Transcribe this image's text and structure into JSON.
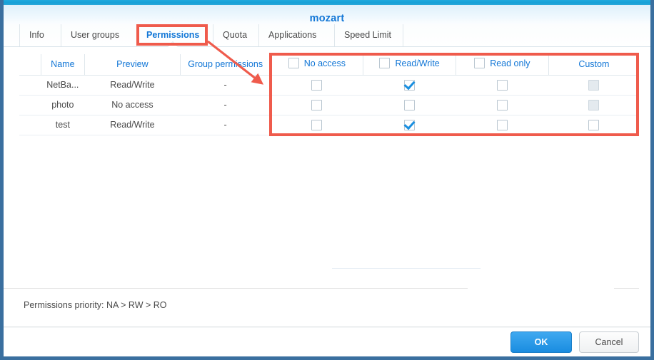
{
  "window": {
    "title": "mozart"
  },
  "tabs": [
    {
      "label": "Info",
      "active": false
    },
    {
      "label": "User groups",
      "active": false
    },
    {
      "label": "Permissions",
      "active": true
    },
    {
      "label": "Quota",
      "active": false
    },
    {
      "label": "Applications",
      "active": false
    },
    {
      "label": "Speed Limit",
      "active": false
    }
  ],
  "table": {
    "headers": {
      "gutter": "",
      "name": "Name",
      "preview": "Preview",
      "group_permissions": "Group permissions",
      "no_access": "No access",
      "read_write": "Read/Write",
      "read_only": "Read only",
      "custom": "Custom"
    },
    "rows": [
      {
        "name": "NetBa...",
        "preview": "Read/Write",
        "preview_state": "read-write",
        "group_permissions": "-",
        "no_access": {
          "checked": false,
          "disabled": false
        },
        "read_write": {
          "checked": true,
          "disabled": false
        },
        "read_only": {
          "checked": false,
          "disabled": false
        },
        "custom": {
          "checked": false,
          "disabled": true
        }
      },
      {
        "name": "photo",
        "preview": "No access",
        "preview_state": "no-access",
        "group_permissions": "-",
        "no_access": {
          "checked": false,
          "disabled": false
        },
        "read_write": {
          "checked": false,
          "disabled": false
        },
        "read_only": {
          "checked": false,
          "disabled": false
        },
        "custom": {
          "checked": false,
          "disabled": true
        }
      },
      {
        "name": "test",
        "preview": "Read/Write",
        "preview_state": "read-write",
        "group_permissions": "-",
        "no_access": {
          "checked": false,
          "disabled": false
        },
        "read_write": {
          "checked": true,
          "disabled": false
        },
        "read_only": {
          "checked": false,
          "disabled": false
        },
        "custom": {
          "checked": false,
          "disabled": false
        }
      }
    ],
    "header_checkboxes": {
      "no_access": {
        "checked": false
      },
      "read_write": {
        "checked": false
      },
      "read_only": {
        "checked": false
      }
    }
  },
  "footer": {
    "priority_note": "Permissions priority: NA > RW > RO",
    "ok_label": "OK",
    "cancel_label": "Cancel"
  },
  "annotations": {
    "tab_highlight_target": "Permissions",
    "table_highlight_target": "permission checkbox columns",
    "arrow": "points from Permissions tab to permission checkbox columns"
  },
  "colors": {
    "accent_blue": "#1176d6",
    "title_strip": "#16a0d8",
    "read_write_orange": "#f0851e",
    "no_access_red": "#ef4136",
    "annotation_red": "#ef5b4c",
    "dialog_border": "#3a6f9f",
    "primary_button": "#1a8ce0"
  }
}
